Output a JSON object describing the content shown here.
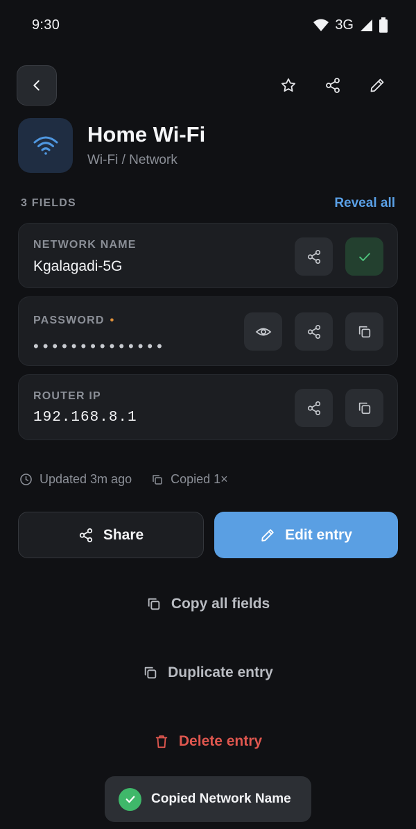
{
  "status_bar": {
    "time": "9:30",
    "network": "3G"
  },
  "entry": {
    "title": "Home Wi-Fi",
    "subtitle": "Wi-Fi / Network"
  },
  "fields_header": {
    "count_label": "3 FIELDS",
    "reveal_all": "Reveal all"
  },
  "fields": [
    {
      "label": "NETWORK NAME",
      "value": "Kgalagadi-5G"
    },
    {
      "label": "PASSWORD",
      "required_marker": "•",
      "value": "••••••••••••••"
    },
    {
      "label": "ROUTER IP",
      "value": "192.168.8.1"
    }
  ],
  "meta": {
    "updated": "Updated 3m ago",
    "copied": "Copied 1×"
  },
  "buttons": {
    "share": "Share",
    "edit": "Edit entry"
  },
  "actions": {
    "copy_all": "Copy all fields",
    "duplicate": "Duplicate entry",
    "delete": "Delete entry"
  },
  "toast": {
    "message": "Copied Network Name"
  },
  "colors": {
    "accent": "#5a9fe3",
    "danger": "#e0574f",
    "success": "#3fb86a",
    "warning": "#e0913a"
  }
}
